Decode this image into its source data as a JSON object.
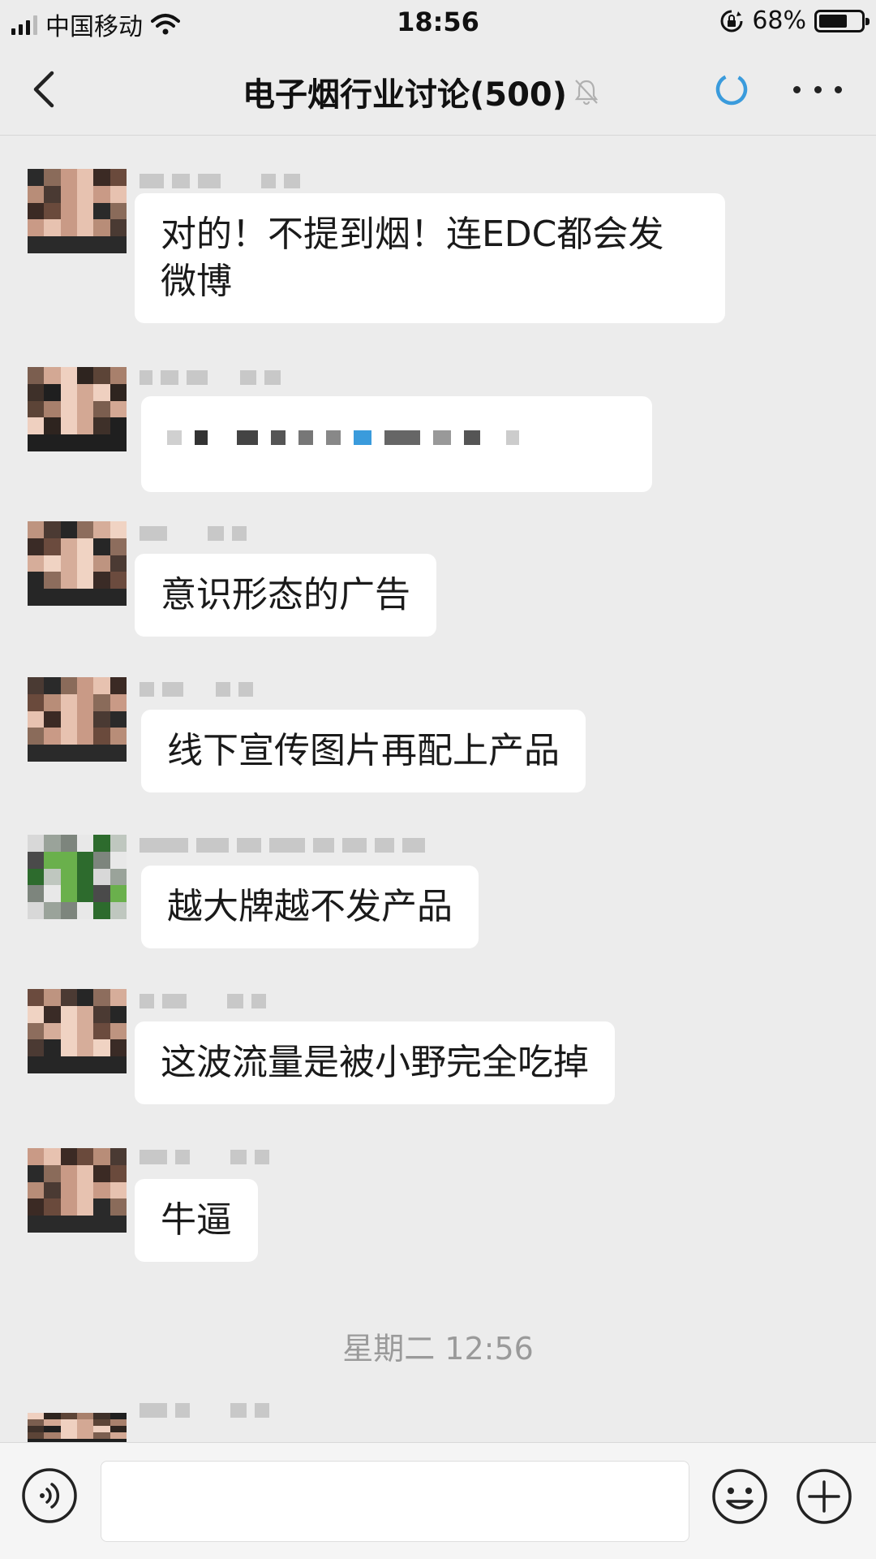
{
  "status_bar": {
    "carrier": "中国移动",
    "time": "18:56",
    "battery_percent": "68%",
    "battery_level": 0.68,
    "icons": [
      "signal-icon",
      "wifi-icon",
      "rotation-lock-icon",
      "battery-icon"
    ]
  },
  "nav": {
    "title": "电子烟行业讨论(500)",
    "icons": {
      "back": "back-chevron-icon",
      "mute": "muted-bell-icon",
      "loading": "loading-spinner-icon",
      "more": "more-dots-icon"
    },
    "accent_color": "#3a9bdc"
  },
  "messages": [
    {
      "text": "对的！不提到烟！连EDC都会发\n微博",
      "sender_visible": false
    },
    {
      "text": "",
      "blurred": true,
      "sender_visible": false
    },
    {
      "text": "意识形态的广告",
      "sender_visible": false
    },
    {
      "text": "线下宣传图片再配上产品",
      "sender_visible": false
    },
    {
      "text": "越大牌越不发产品",
      "sender_visible": false
    },
    {
      "text": "这波流量是被小野完全吃掉",
      "sender_visible": false
    },
    {
      "text": "牛逼",
      "sender_visible": false
    }
  ],
  "timestamp": "星期二 12:56",
  "input_bar": {
    "placeholder": "",
    "icons": {
      "voice": "voice-icon",
      "emoji": "emoji-icon",
      "plus": "plus-icon"
    }
  },
  "colors": {
    "background": "#ececec",
    "bubble": "#ffffff",
    "text": "#1a1a1a",
    "timestamp": "#9a9a9a"
  }
}
